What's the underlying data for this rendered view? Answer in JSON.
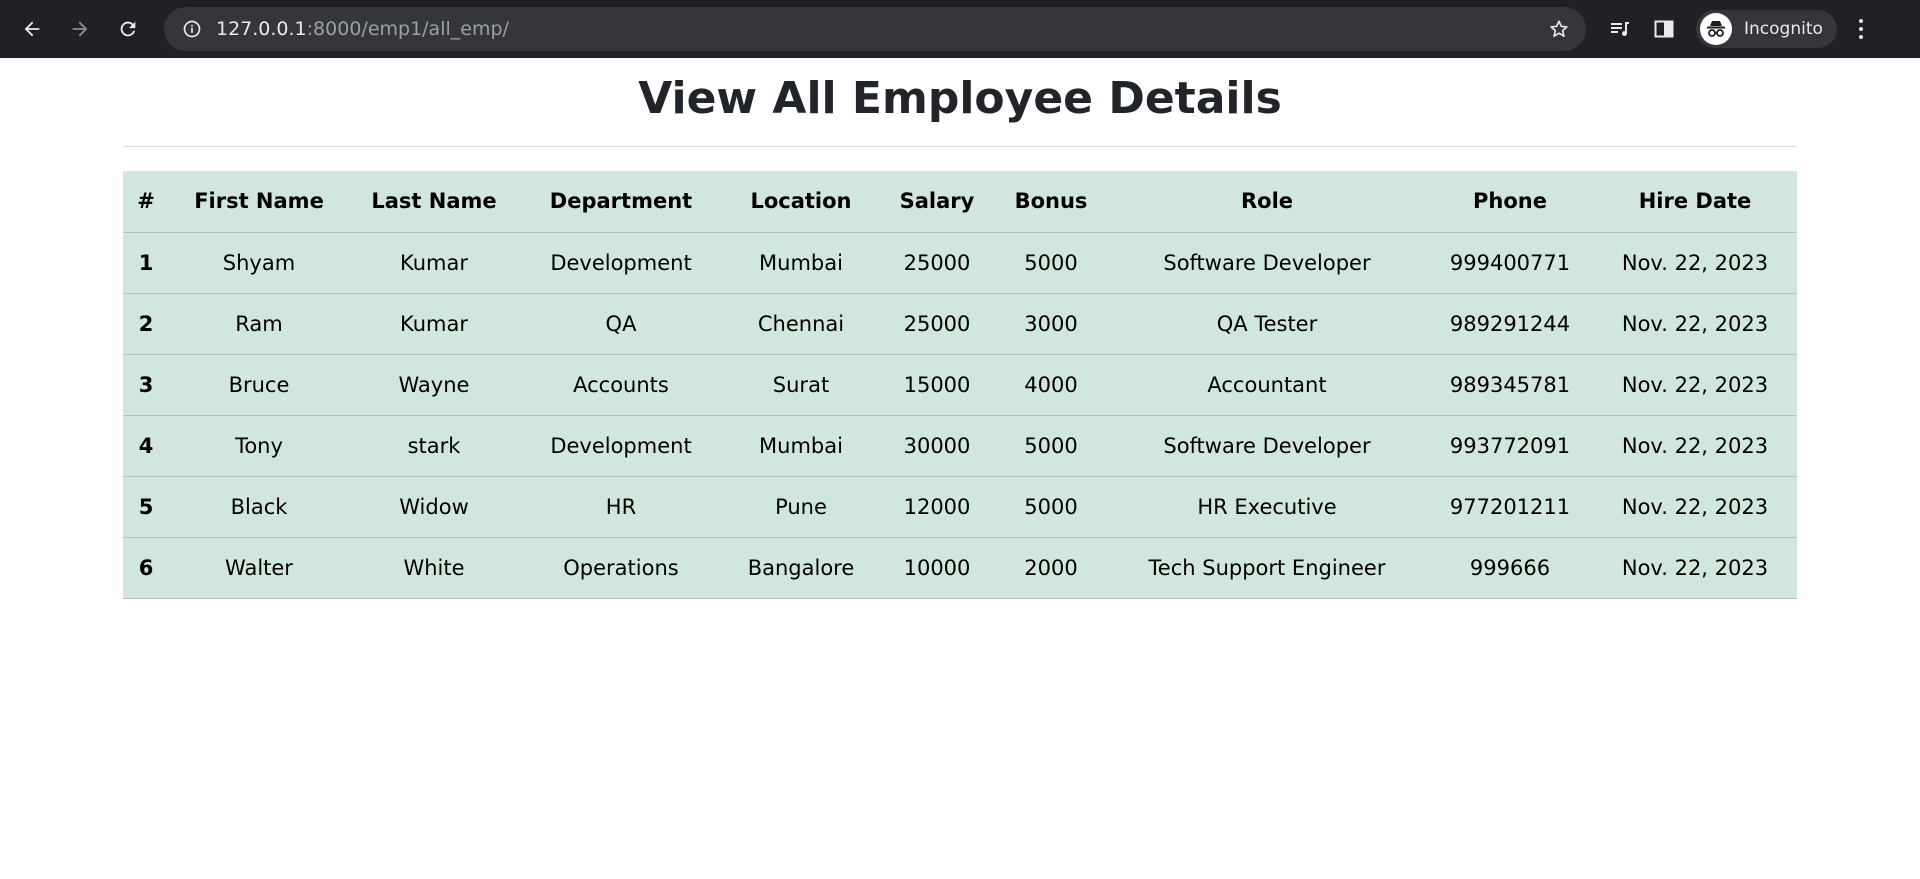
{
  "browser": {
    "url_host": "127.0.0.1",
    "url_path": ":8000/emp1/all_emp/",
    "profile_label": "Incognito"
  },
  "page": {
    "title": "View All Employee Details"
  },
  "table": {
    "headers": [
      "#",
      "First Name",
      "Last Name",
      "Department",
      "Location",
      "Salary",
      "Bonus",
      "Role",
      "Phone",
      "Hire Date"
    ],
    "rows": [
      [
        "1",
        "Shyam",
        "Kumar",
        "Development",
        "Mumbai",
        "25000",
        "5000",
        "Software Developer",
        "999400771",
        "Nov. 22, 2023"
      ],
      [
        "2",
        "Ram",
        "Kumar",
        "QA",
        "Chennai",
        "25000",
        "3000",
        "QA Tester",
        "989291244",
        "Nov. 22, 2023"
      ],
      [
        "3",
        "Bruce",
        "Wayne",
        "Accounts",
        "Surat",
        "15000",
        "4000",
        "Accountant",
        "989345781",
        "Nov. 22, 2023"
      ],
      [
        "4",
        "Tony",
        "stark",
        "Development",
        "Mumbai",
        "30000",
        "5000",
        "Software Developer",
        "993772091",
        "Nov. 22, 2023"
      ],
      [
        "5",
        "Black",
        "Widow",
        "HR",
        "Pune",
        "12000",
        "5000",
        "HR Executive",
        "977201211",
        "Nov. 22, 2023"
      ],
      [
        "6",
        "Walter",
        "White",
        "Operations",
        "Bangalore",
        "10000",
        "2000",
        "Tech Support Engineer",
        "999666",
        "Nov. 22, 2023"
      ]
    ]
  },
  "colors": {
    "chrome_bg": "#202124",
    "table_bg": "#d1e7dd"
  }
}
